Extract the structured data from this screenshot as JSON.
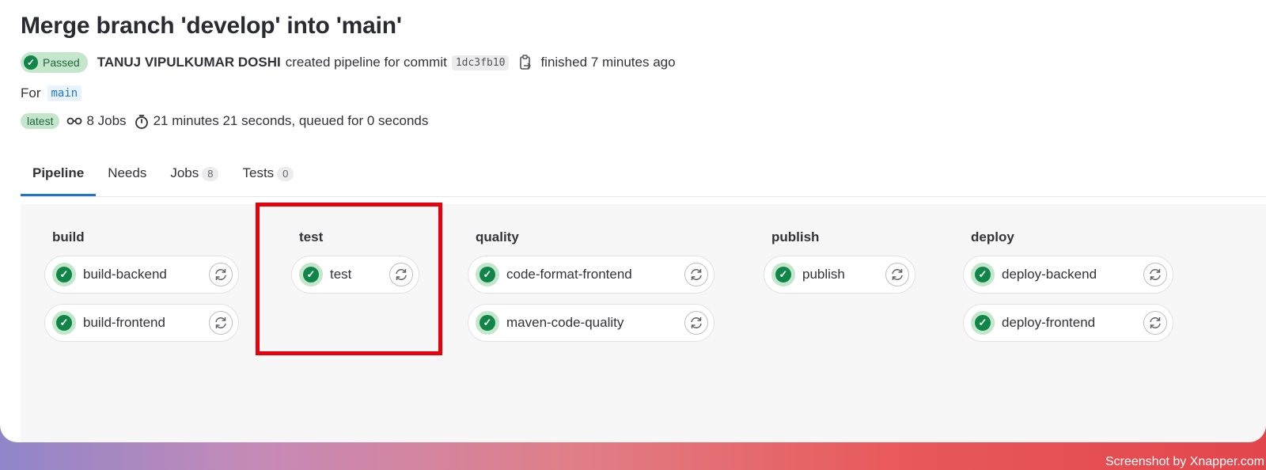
{
  "page": {
    "title": "Merge branch 'develop' into 'main'",
    "status_badge": "Passed",
    "author": "TANUJ VIPULKUMAR DOSHI",
    "created_text": "created pipeline for commit",
    "commit_sha": "1dc3fb10",
    "finished_text": "finished 7 minutes ago",
    "for_label": "For",
    "branch": "main",
    "latest_badge": "latest",
    "jobs_count_text": "8 Jobs",
    "duration_text": "21 minutes 21 seconds, queued for 0 seconds"
  },
  "tabs": [
    {
      "label": "Pipeline",
      "count": "",
      "active": true
    },
    {
      "label": "Needs",
      "count": "",
      "active": false
    },
    {
      "label": "Jobs",
      "count": "8",
      "active": false
    },
    {
      "label": "Tests",
      "count": "0",
      "active": false
    }
  ],
  "stages": [
    {
      "name": "build",
      "jobs": [
        {
          "name": "build-backend",
          "status": "passed"
        },
        {
          "name": "build-frontend",
          "status": "passed"
        }
      ]
    },
    {
      "name": "test",
      "jobs": [
        {
          "name": "test",
          "status": "passed"
        }
      ]
    },
    {
      "name": "quality",
      "jobs": [
        {
          "name": "code-format-frontend",
          "status": "passed"
        },
        {
          "name": "maven-code-quality",
          "status": "passed"
        }
      ]
    },
    {
      "name": "publish",
      "jobs": [
        {
          "name": "publish",
          "status": "passed"
        }
      ]
    },
    {
      "name": "deploy",
      "jobs": [
        {
          "name": "deploy-backend",
          "status": "passed"
        },
        {
          "name": "deploy-frontend",
          "status": "passed"
        }
      ]
    }
  ],
  "icons": {
    "status_passed": "check-circle-icon",
    "retry": "retry-icon",
    "copy": "copy-icon",
    "jobs": "pipeline-icon",
    "timer": "timer-icon"
  },
  "colors": {
    "success": "#108548",
    "success_bg": "#c3e6cd",
    "tab_active": "#1f75cb",
    "highlight": "#e8000d"
  },
  "watermark": "Screenshot by Xnapper.com"
}
